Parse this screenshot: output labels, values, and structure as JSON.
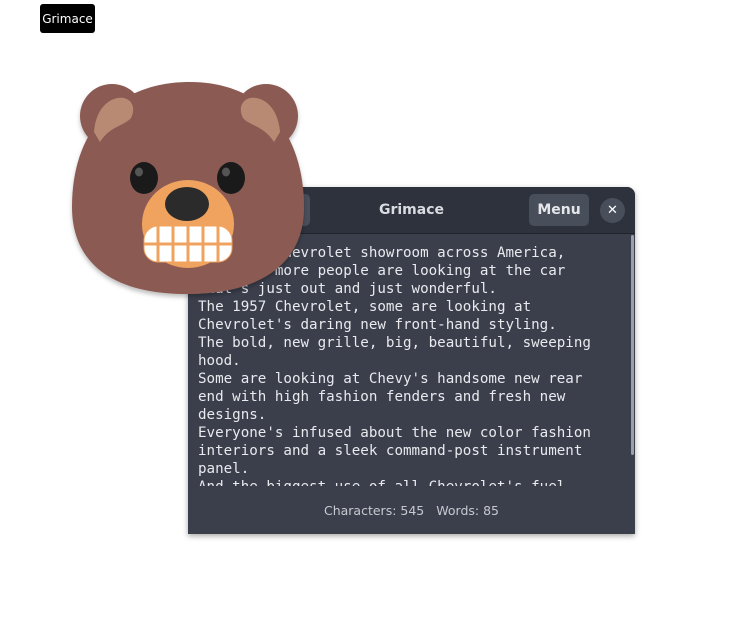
{
  "tooltip": {
    "text": "Grimace"
  },
  "window": {
    "title": "Grimace",
    "menu_label": "Menu",
    "close_icon": "close-icon",
    "text_lines": [
      "In every Chevrolet showroom across America,",
      "more and more people are looking at the car",
      "that's just out and just wonderful.",
      "The 1957 Chevrolet, some are looking at",
      "Chevrolet's daring new front-hand styling.",
      "The bold, new grille, big, beautiful, sweeping",
      "hood.",
      "Some are looking at Chevy's handsome new rear",
      "end with high fashion fenders and fresh new",
      "designs.",
      "Everyone's infused about the new color fashion",
      "interiors and a sleek command-post instrument",
      "panel.",
      "And the biggest use of all Chevrolet's fuel"
    ],
    "status": {
      "characters": "Characters: 545",
      "words": "Words: 85"
    }
  },
  "emoji": {
    "icon": "grimacing-bear-icon"
  },
  "colors": {
    "window_bg": "#3b3f4c",
    "headerbar_bg": "#2e323d",
    "bear_fur": "#8b5a52",
    "bear_muzzle": "#f0a35e"
  }
}
